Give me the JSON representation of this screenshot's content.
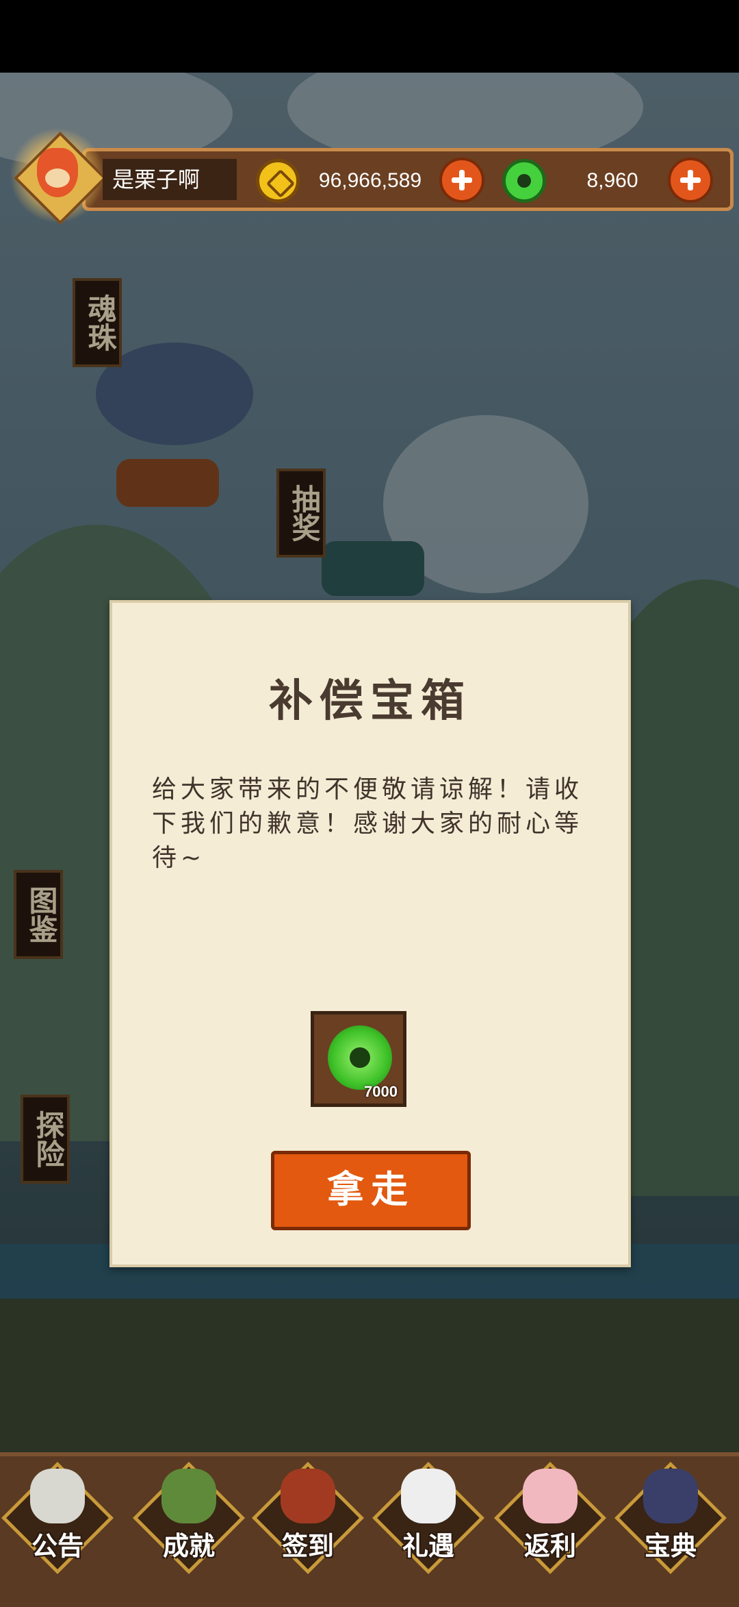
{
  "player": {
    "name": "是栗子啊"
  },
  "currency": {
    "gold_amount": "96,966,589",
    "jade_amount": "8,960"
  },
  "side_signs": [
    "魂珠",
    "抽奖",
    "图鉴",
    "探险"
  ],
  "dialog": {
    "title": "补偿宝箱",
    "message": "给大家带来的不便敬请谅解！请收下我们的歉意！感谢大家的耐心等待~",
    "reward_quantity": "7000",
    "take_button": "拿走"
  },
  "bottom_nav": [
    {
      "label": "公告"
    },
    {
      "label": "成就"
    },
    {
      "label": "签到"
    },
    {
      "label": "礼遇"
    },
    {
      "label": "返利"
    },
    {
      "label": "宝典"
    }
  ],
  "colors": {
    "accent_orange": "#e2590f",
    "jade_green": "#45d13e",
    "gold": "#f2c21b"
  }
}
